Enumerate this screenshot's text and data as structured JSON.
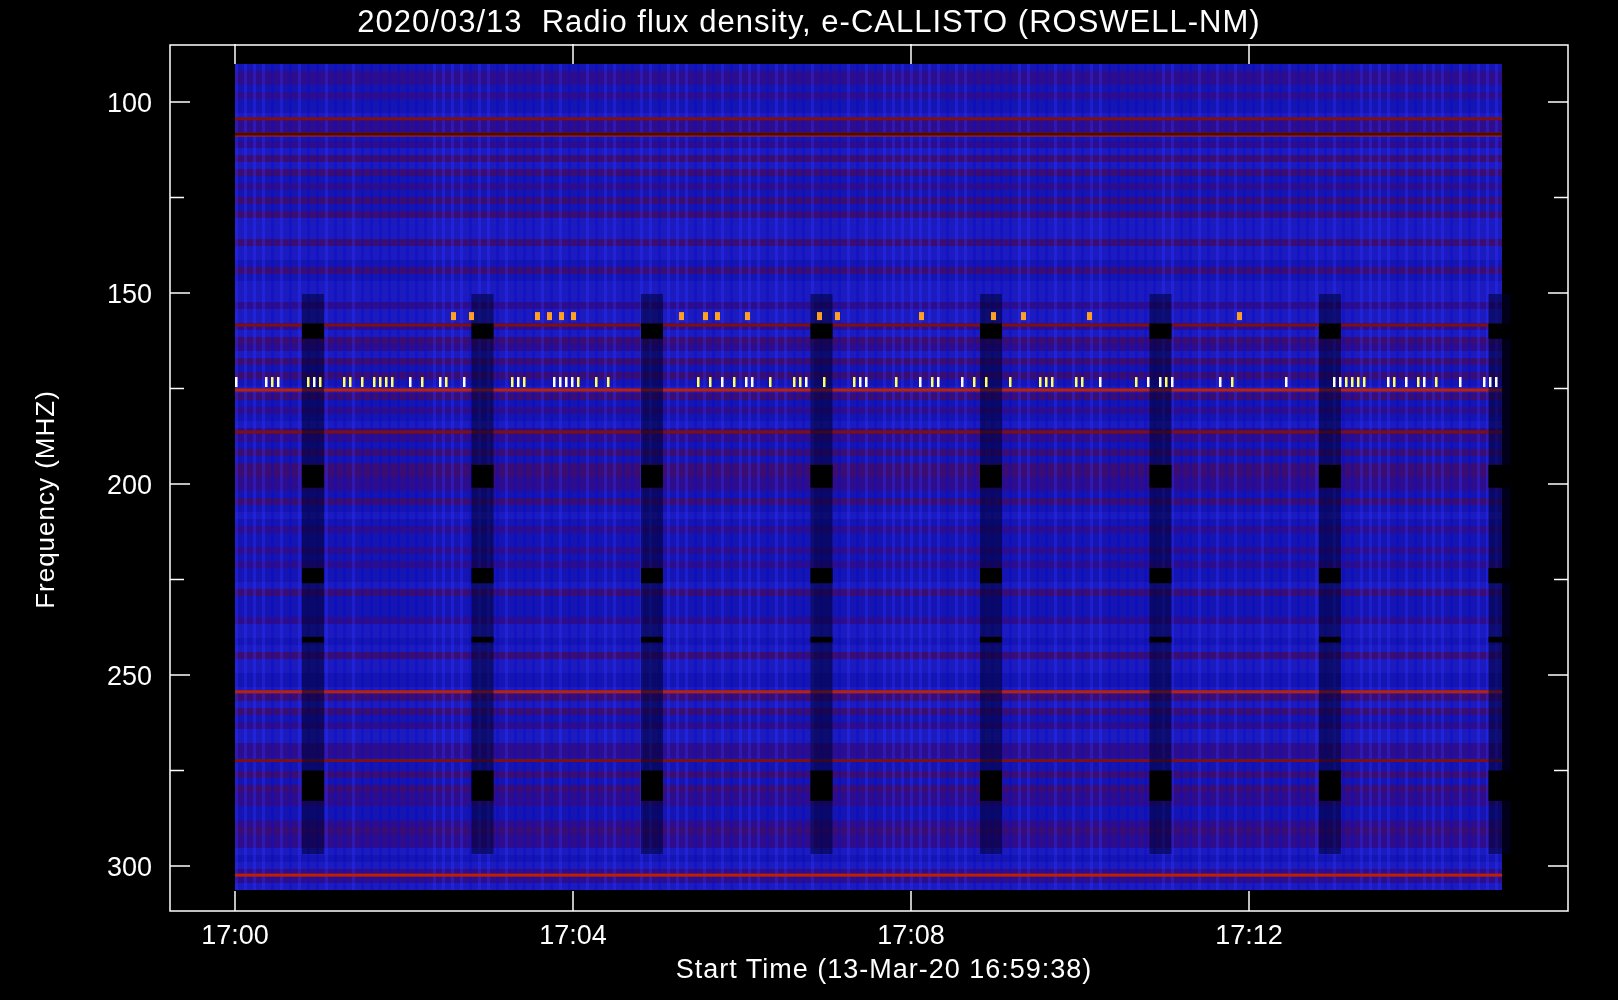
{
  "title": "2020/03/13  Radio flux density, e-CALLISTO (ROSWELL-NM)",
  "y_axis": {
    "label": "Frequency (MHZ)",
    "ticks": [
      "100",
      "150",
      "200",
      "250",
      "300"
    ]
  },
  "x_axis": {
    "label": "Start Time (13-Mar-20 16:59:38)",
    "ticks": [
      "17:00",
      "17:04",
      "17:08",
      "17:12"
    ]
  }
}
